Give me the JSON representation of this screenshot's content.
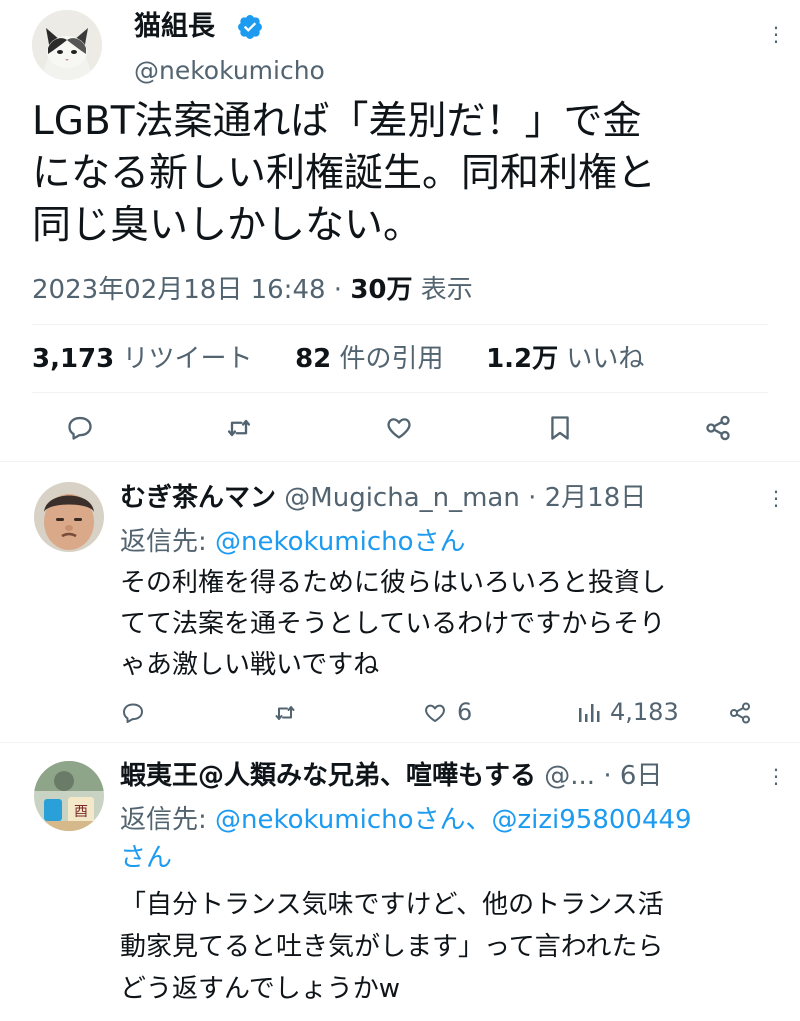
{
  "main_tweet": {
    "display_name": "猫組長",
    "handle": "@nekokumicho",
    "text_lines": [
      "LGBT法案通れば「差別だ！」で金",
      "になる新しい利権誕生。同和利権と",
      "同じ臭いしかしない。"
    ],
    "timestamp": "2023年02月18日 16:48",
    "separator": "·",
    "views_count": "30万",
    "views_label": "表示",
    "stats": {
      "retweets_count": "3,173",
      "retweets_label": "リツイート",
      "quotes_count": "82",
      "quotes_label": "件の引用",
      "likes_count": "1.2万",
      "likes_label": "いいね"
    },
    "more_label": "⋮"
  },
  "replies": [
    {
      "display_name": "むぎ茶んマン",
      "handle": "@Mugicha_n_man",
      "date": "· 2月18日",
      "reply_to_prefix": "返信先:",
      "reply_to_users": "@nekokumichoさん",
      "text_lines": [
        "その利権を得るために彼らはいろいろと投資し",
        "てて法案を通そうとしているわけですからそり",
        "ゃあ激しい戦いですね"
      ],
      "likes": "6",
      "views": "4,183",
      "more_label": "⋮"
    },
    {
      "display_name": "蝦夷王@人類みな兄弟、喧嘩もする",
      "handle": "@...",
      "date": "· 6日",
      "reply_to_prefix": "返信先:",
      "reply_to_users_line1": "@nekokumichoさん、@zizi95800449",
      "reply_to_users_line2": "さん",
      "text_lines": [
        "「自分トランス気味ですけど、他のトランス活",
        "動家見てると吐き気がします」って言われたら",
        "どう返すんでしょうかw"
      ],
      "more_label": "⋮"
    }
  ],
  "colors": {
    "verified_badge": "#1d9bf0",
    "link_blue": "#1d9bf0",
    "secondary_text": "#536471",
    "divider": "#eff3f4"
  },
  "icons": [
    "verified-icon",
    "reply-icon",
    "retweet-icon",
    "like-icon",
    "bookmark-icon",
    "share-icon",
    "views-icon",
    "more-icon"
  ]
}
